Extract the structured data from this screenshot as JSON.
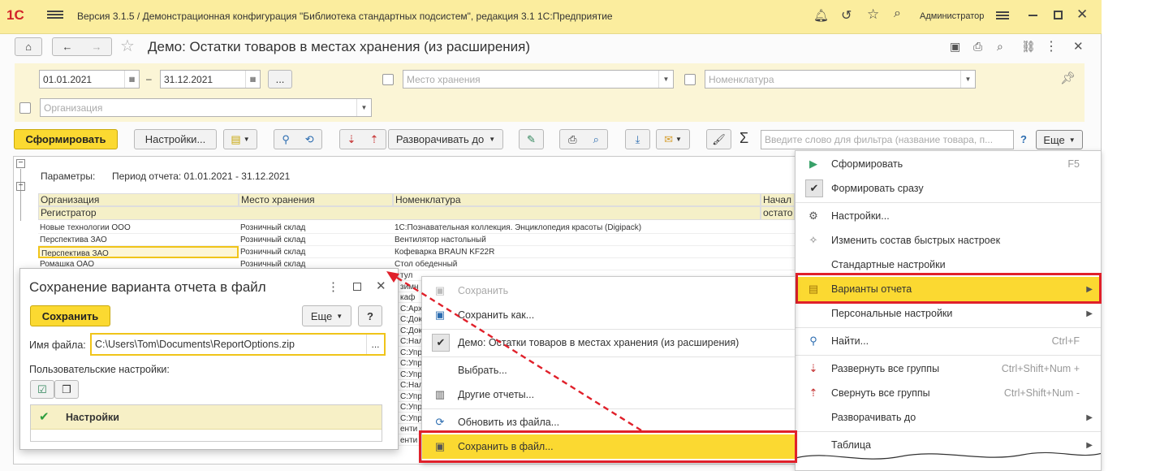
{
  "titlebar": {
    "logo": "1С",
    "title": "Версия 3.1.5 / Демонстрационная конфигурация \"Библиотека стандартных подсистем\", редакция 3.1 1С:Предприятие",
    "user": "Администратор",
    "accent": "#fbed9e"
  },
  "header": {
    "title": "Демо: Остатки товаров в местах хранения (из расширения)"
  },
  "filters": {
    "date_from": "01.01.2021",
    "date_dash": "–",
    "date_to": "31.12.2021",
    "period_btn": "...",
    "storage_placeholder": "Место хранения",
    "nomenclature_placeholder": "Номенклатура",
    "org_placeholder": "Организация"
  },
  "toolbar": {
    "generate": "Сформировать",
    "settings": "Настройки...",
    "expand_to": "Разворачивать до",
    "search_placeholder": "Введите слово для фильтра (название товара, п...",
    "help": "?",
    "more": "Еще",
    "sigma": "Σ"
  },
  "report": {
    "params_label": "Параметры:",
    "period": "Период отчета: 01.01.2021 - 31.12.2021",
    "columns": [
      "Организация",
      "Место хранения",
      "Номенклатура",
      "Начал"
    ],
    "sub_header": "Регистратор",
    "sub_header_last": "остато",
    "rows": [
      [
        "Новые технологии ООО",
        "Розничный склад",
        "1С:Познавательная коллекция. Энциклопедия красоты (Digipack)"
      ],
      [
        "Перспектива ЗАО",
        "Розничный склад",
        "Вентилятор настольный"
      ],
      [
        "Перспектива ЗАО",
        "Розничный склад",
        "Кофеварка BRAUN KF22R"
      ],
      [
        "Ромашка ОАО",
        "Розничный склад",
        "Стол обеденный"
      ]
    ],
    "partial_rows": [
      "тул",
      "зимн",
      "каф",
      "С:Арх",
      "С:Док",
      "С:Док",
      "С:Нал",
      "С:Упр",
      "С:Упр",
      "С:Упр",
      "С:Нал",
      "С:Упр",
      "С:Упр",
      "С:Упр",
      "енти",
      "енти"
    ]
  },
  "more_menu": {
    "items": [
      {
        "label": "Сформировать",
        "shortcut": "F5",
        "icon": "play-icon"
      },
      {
        "label": "Формировать сразу",
        "icon": "checkmark-icon"
      },
      {
        "label": "Настройки...",
        "icon": "settings-icon"
      },
      {
        "label": "Изменить состав быстрых настроек",
        "icon": "pin-icon"
      },
      {
        "label": "Стандартные настройки"
      },
      {
        "label": "Варианты отчета",
        "icon": "report-variants-icon"
      },
      {
        "label": "Персональные настройки"
      },
      {
        "label": "Найти...",
        "shortcut": "Ctrl+F",
        "icon": "search-icon"
      },
      {
        "label": "Развернуть все группы",
        "shortcut": "Ctrl+Shift+Num +",
        "icon": "expand-icon"
      },
      {
        "label": "Свернуть все группы",
        "shortcut": "Ctrl+Shift+Num -",
        "icon": "collapse-icon"
      },
      {
        "label": "Разворачивать до"
      },
      {
        "label": "Таблица"
      }
    ]
  },
  "variants_menu": {
    "items": [
      {
        "label": "Сохранить",
        "disabled": true
      },
      {
        "label": "Сохранить как..."
      },
      {
        "label": "Демо: Остатки товаров в местах хранения (из расширения)"
      },
      {
        "label": "Выбрать..."
      },
      {
        "label": "Другие отчеты..."
      },
      {
        "label": "Обновить из файла..."
      },
      {
        "label": "Сохранить в файл..."
      }
    ]
  },
  "dialog": {
    "title": "Сохранение варианта отчета в файл",
    "save": "Сохранить",
    "more": "Еще",
    "help": "?",
    "file_label": "Имя файла:",
    "file_value": "C:\\Users\\Tom\\Documents\\ReportOptions.zip",
    "browse": "...",
    "user_settings_label": "Пользовательские настройки:",
    "settings_row": "Настройки"
  },
  "colors": {
    "yellow_button": "#fbd931",
    "highlight": "#fbd931",
    "red_frame": "#e0202a"
  }
}
